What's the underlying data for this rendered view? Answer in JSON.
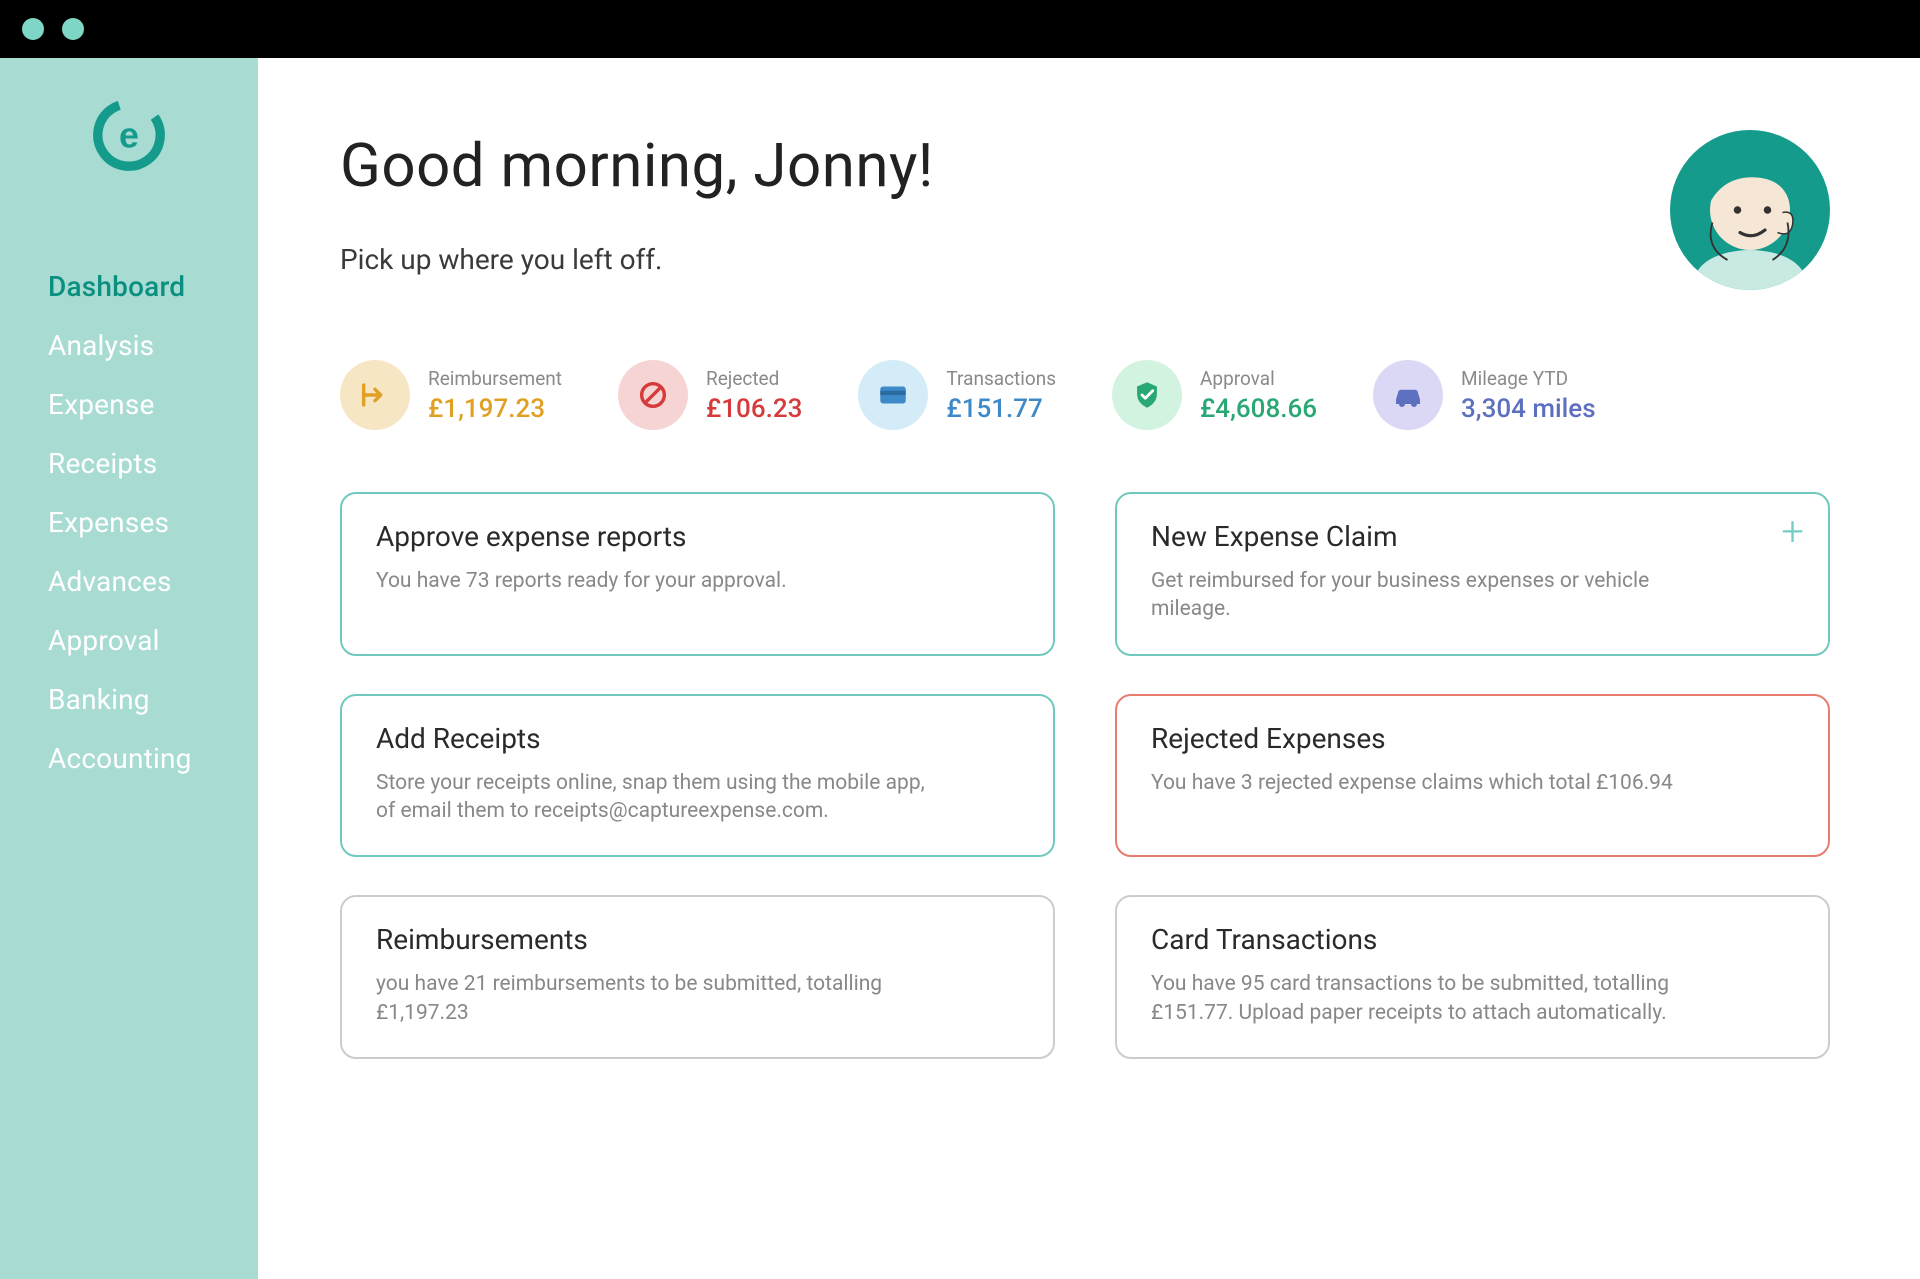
{
  "sidebar": {
    "items": [
      {
        "label": "Dashboard",
        "active": true
      },
      {
        "label": "Analysis",
        "active": false
      },
      {
        "label": "Expense",
        "active": false
      },
      {
        "label": "Receipts",
        "active": false
      },
      {
        "label": "Expenses",
        "active": false
      },
      {
        "label": "Advances",
        "active": false
      },
      {
        "label": "Approval",
        "active": false
      },
      {
        "label": "Banking",
        "active": false
      },
      {
        "label": "Accounting",
        "active": false
      }
    ]
  },
  "header": {
    "greeting": "Good morning, Jonny!",
    "subtitle": "Pick up where you left off."
  },
  "stats": {
    "reimbursement": {
      "label": "Reimbursement",
      "value": "£1,197.23",
      "icon": "arrow-out-icon"
    },
    "rejected": {
      "label": "Rejected",
      "value": "£106.23",
      "icon": "no-entry-icon"
    },
    "transactions": {
      "label": "Transactions",
      "value": "£151.77",
      "icon": "card-icon"
    },
    "approval": {
      "label": "Approval",
      "value": "£4,608.66",
      "icon": "shield-check-icon"
    },
    "mileage": {
      "label": "Mileage YTD",
      "value": "3,304 miles",
      "icon": "car-icon"
    }
  },
  "cards": {
    "approve": {
      "title": "Approve expense reports",
      "body": "You have 73 reports ready for your approval."
    },
    "newclaim": {
      "title": "New Expense Claim",
      "body": "Get reimbursed for your business expenses or vehicle mileage."
    },
    "receipts": {
      "title": "Add Receipts",
      "body": "Store your receipts online, snap them using the mobile app, of email them to receipts@captureexpense.com."
    },
    "rejected": {
      "title": "Rejected Expenses",
      "body": "You have 3 rejected expense claims which total £106.94"
    },
    "reimb": {
      "title": "Reimbursements",
      "body": "you have 21 reimbursements to be submitted, totalling £1,197.23"
    },
    "cardtx": {
      "title": "Card Transactions",
      "body": "You have 95 card transactions to be submitted, totalling £151.77. Upload paper receipts to attach automatically."
    }
  }
}
